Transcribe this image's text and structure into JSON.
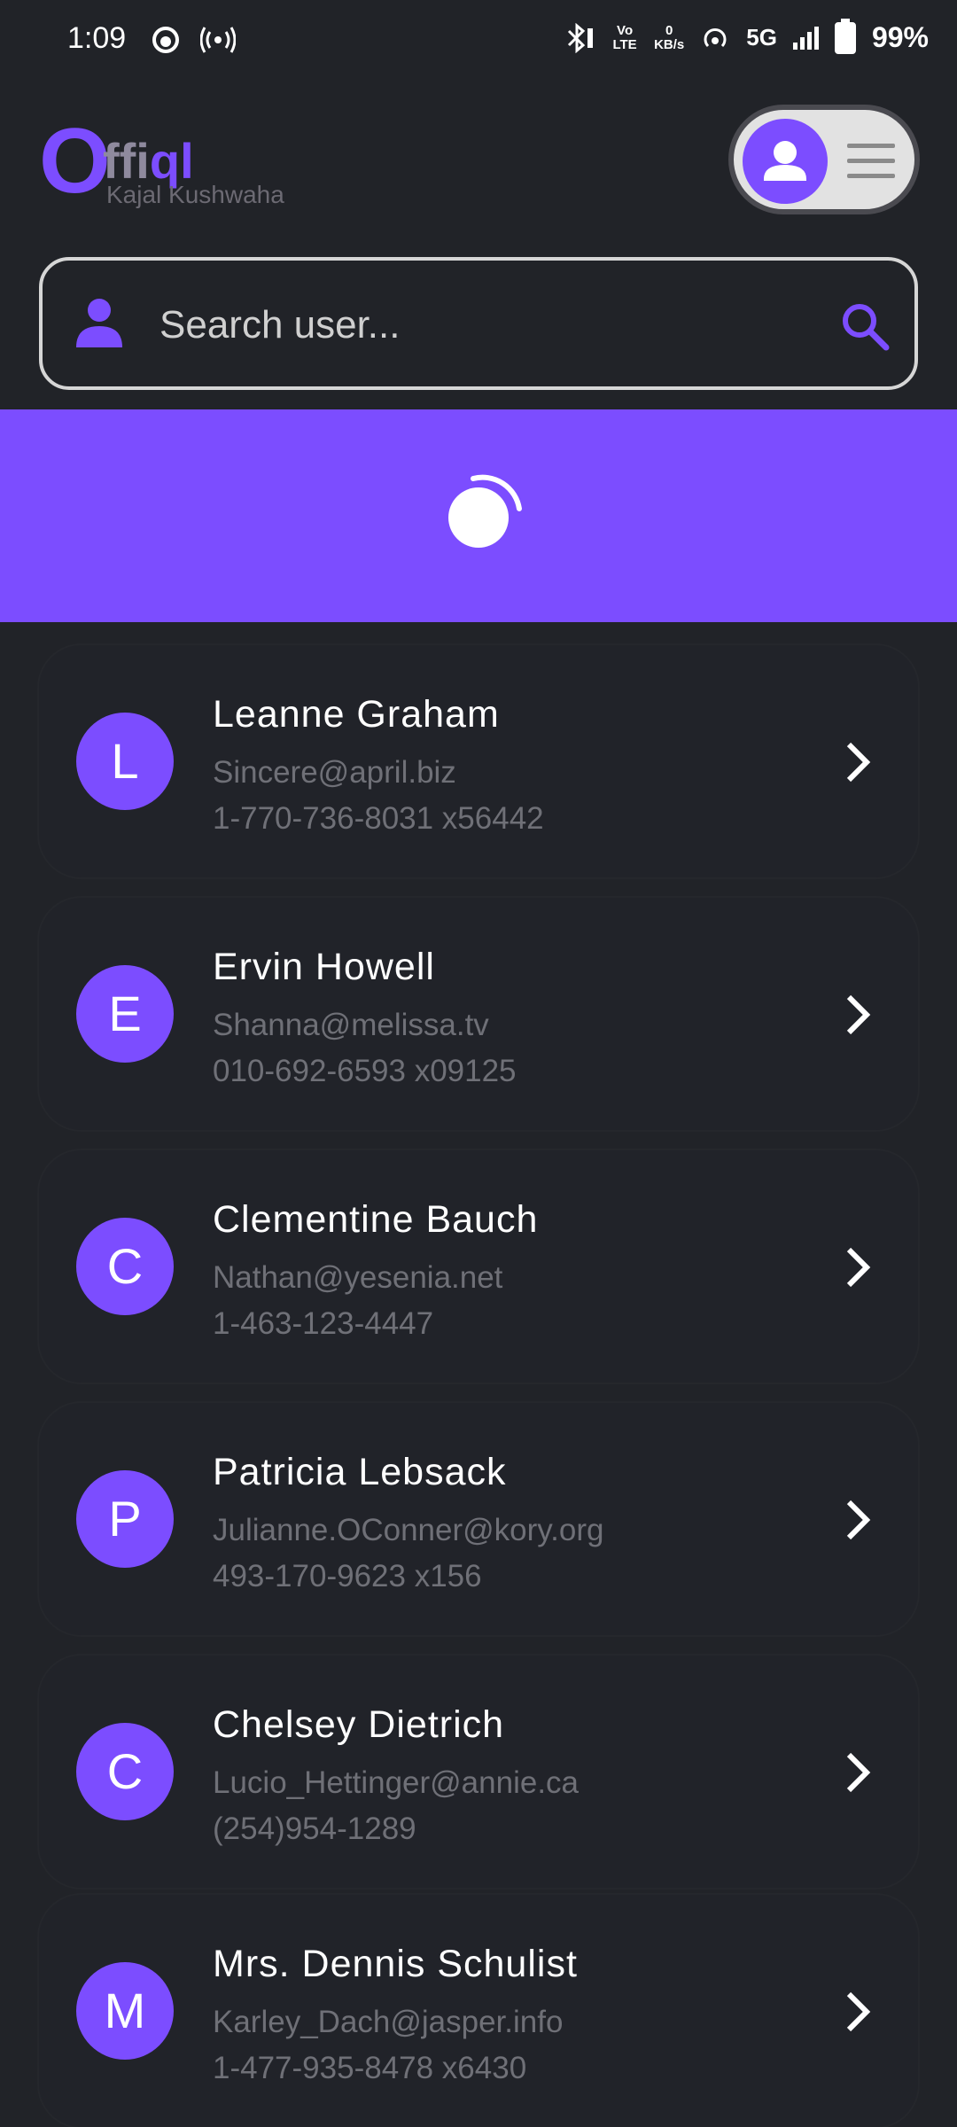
{
  "status_bar": {
    "time": "1:09",
    "network": "5G",
    "volte": "Vo LTE",
    "speed_value": "0",
    "speed_unit": "KB/s",
    "battery": "99%"
  },
  "header": {
    "logo_first": "O",
    "logo_rest_a": "ffi",
    "logo_rest_b": "ql",
    "subtitle": "Kajal Kushwaha"
  },
  "search": {
    "placeholder": "Search user..."
  },
  "colors": {
    "accent": "#7c4dff",
    "background": "#212328",
    "muted_text": "#6f7077"
  },
  "users": [
    {
      "initial": "L",
      "name": "Leanne Graham",
      "email": "Sincere@april.biz",
      "phone": "1-770-736-8031 x56442"
    },
    {
      "initial": "E",
      "name": "Ervin Howell",
      "email": "Shanna@melissa.tv",
      "phone": "010-692-6593 x09125"
    },
    {
      "initial": "C",
      "name": "Clementine Bauch",
      "email": "Nathan@yesenia.net",
      "phone": "1-463-123-4447"
    },
    {
      "initial": "P",
      "name": "Patricia Lebsack",
      "email": "Julianne.OConner@kory.org",
      "phone": "493-170-9623 x156"
    },
    {
      "initial": "C",
      "name": "Chelsey Dietrich",
      "email": "Lucio_Hettinger@annie.ca",
      "phone": "(254)954-1289"
    },
    {
      "initial": "M",
      "name": "Mrs. Dennis Schulist",
      "email": "Karley_Dach@jasper.info",
      "phone": "1-477-935-8478 x6430"
    }
  ]
}
